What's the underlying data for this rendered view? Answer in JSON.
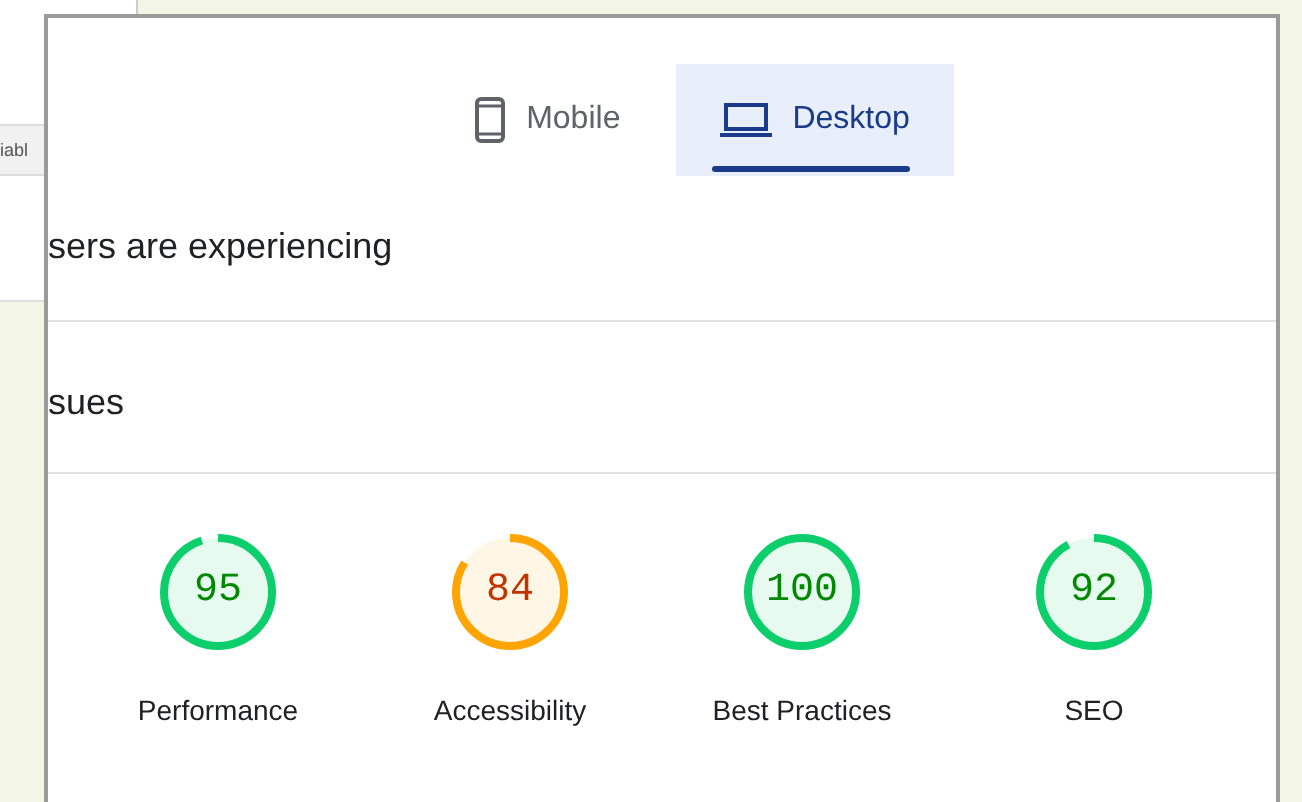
{
  "background_window": {
    "label": "iabl"
  },
  "tabs": [
    {
      "label": "Mobile",
      "kind": "mobile",
      "selected": false
    },
    {
      "label": "Desktop",
      "kind": "desktop",
      "selected": true
    }
  ],
  "sections": [
    {
      "title": "sers are experiencing"
    },
    {
      "title": "sues"
    }
  ],
  "gauges": [
    {
      "score": "95",
      "label": "Performance",
      "level": 0.95,
      "color": "#0cce6b"
    },
    {
      "score": "84",
      "label": "Accessibility",
      "level": 0.84,
      "color": "#ffa400"
    },
    {
      "score": "100",
      "label": "Best Practices",
      "level": 1,
      "color": "#0cce6b"
    },
    {
      "score": "92",
      "label": "SEO",
      "level": 0.92,
      "color": "#0cce6b"
    }
  ]
}
